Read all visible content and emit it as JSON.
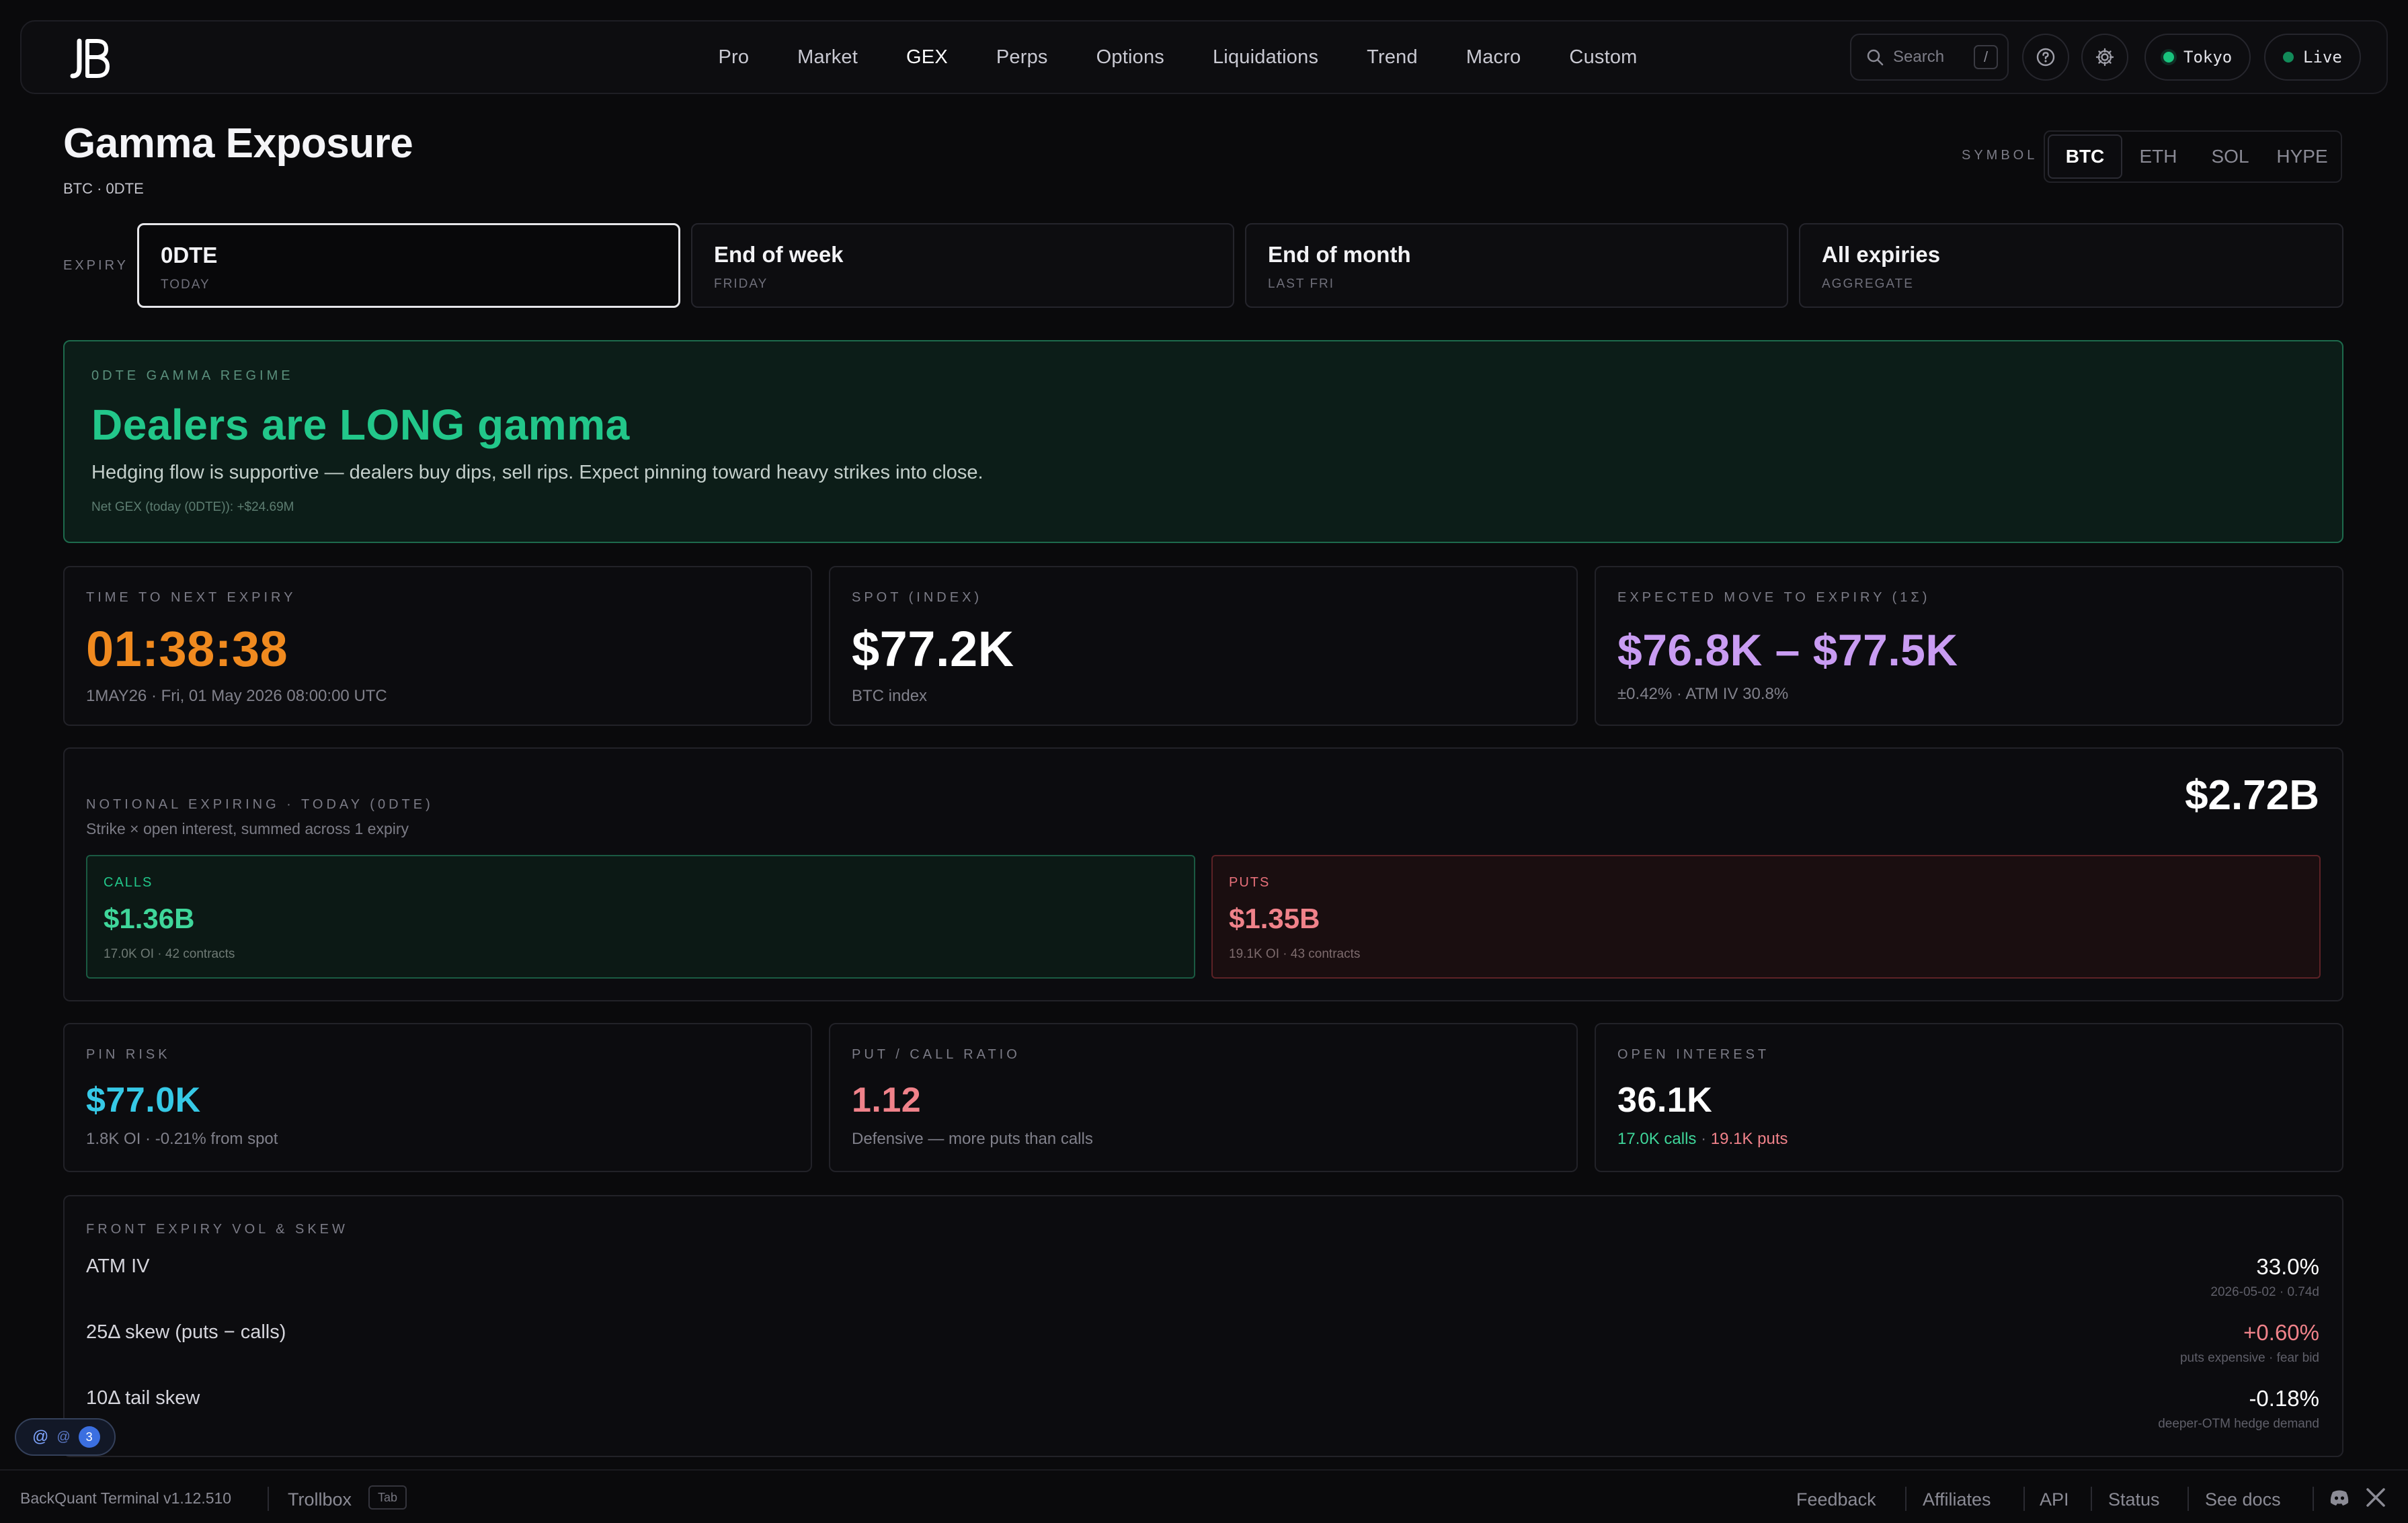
{
  "nav": {
    "items": [
      "Pro",
      "Market",
      "GEX",
      "Perps",
      "Options",
      "Liquidations",
      "Trend",
      "Macro",
      "Custom"
    ],
    "active": "GEX",
    "search_placeholder": "Search",
    "search_shortcut": "/",
    "region": "Tokyo",
    "status": "Live"
  },
  "header": {
    "title": "Gamma Exposure",
    "subtitle": "BTC · 0DTE",
    "symbol_label": "SYMBOL",
    "symbols": [
      "BTC",
      "ETH",
      "SOL",
      "HYPE"
    ],
    "selected_symbol": "BTC"
  },
  "expiry": {
    "label": "EXPIRY",
    "options": [
      {
        "name": "0DTE",
        "sub": "TODAY"
      },
      {
        "name": "End of week",
        "sub": "FRIDAY"
      },
      {
        "name": "End of month",
        "sub": "LAST FRI"
      },
      {
        "name": "All expiries",
        "sub": "AGGREGATE"
      }
    ],
    "selected": "0DTE"
  },
  "regime": {
    "kicker": "0DTE GAMMA REGIME",
    "headline": "Dealers are LONG gamma",
    "body": "Hedging flow is supportive — dealers buy dips, sell rips. Expect pinning toward heavy strikes into close.",
    "foot": "Net GEX (today (0DTE)): +$24.69M"
  },
  "stats_top": [
    {
      "label": "TIME TO NEXT EXPIRY",
      "value": "01:38:38",
      "detail": "1MAY26 · Fri, 01 May 2026 08:00:00 UTC",
      "color": "#f08a1f"
    },
    {
      "label": "SPOT (INDEX)",
      "value": "$77.2K",
      "detail": "BTC index",
      "color": "#ffffff"
    },
    {
      "label": "EXPECTED MOVE TO EXPIRY (1Σ)",
      "value": "$76.8K – $77.5K",
      "detail": "±0.42% · ATM IV 30.8%",
      "color": "#c99cf2"
    }
  ],
  "notional": {
    "label": "NOTIONAL EXPIRING · TODAY (0DTE)",
    "sub": "Strike × open interest, summed across 1 expiry",
    "total": "$2.72B",
    "calls": {
      "label": "CALLS",
      "value": "$1.36B",
      "detail": "17.0K OI · 42 contracts"
    },
    "puts": {
      "label": "PUTS",
      "value": "$1.35B",
      "detail": "19.1K OI · 43 contracts"
    }
  },
  "stats_mid": [
    {
      "label": "PIN RISK",
      "value": "$77.0K",
      "detail": "1.8K OI · -0.21% from spot",
      "color": "#36c9e6"
    },
    {
      "label": "PUT / CALL RATIO",
      "value": "1.12",
      "detail": "Defensive — more puts than calls",
      "color": "#f0828a"
    },
    {
      "label": "OPEN INTEREST",
      "value": "36.1K",
      "calls_detail": "17.0K calls",
      "puts_detail": "19.1K puts",
      "color": "#ffffff"
    }
  ],
  "vol": {
    "label": "FRONT EXPIRY VOL & SKEW",
    "rows": [
      {
        "name": "ATM IV",
        "value": "33.0%",
        "note": "2026-05-02 · 0.74d",
        "color": "#ffffff"
      },
      {
        "name": "25Δ skew (puts − calls)",
        "value": "+0.60%",
        "note": "puts expensive · fear bid",
        "color": "#f0828a"
      },
      {
        "name": "10Δ tail skew",
        "value": "-0.18%",
        "note": "deeper-OTM hedge demand",
        "color": "#ffffff"
      }
    ]
  },
  "bubble": {
    "at": "@",
    "badge": "3"
  },
  "footer": {
    "version": "BackQuant Terminal v1.12.510",
    "trollbox": "Trollbox",
    "tab_key": "Tab",
    "links": [
      "Feedback",
      "Affiliates",
      "API",
      "Status",
      "See docs"
    ]
  }
}
